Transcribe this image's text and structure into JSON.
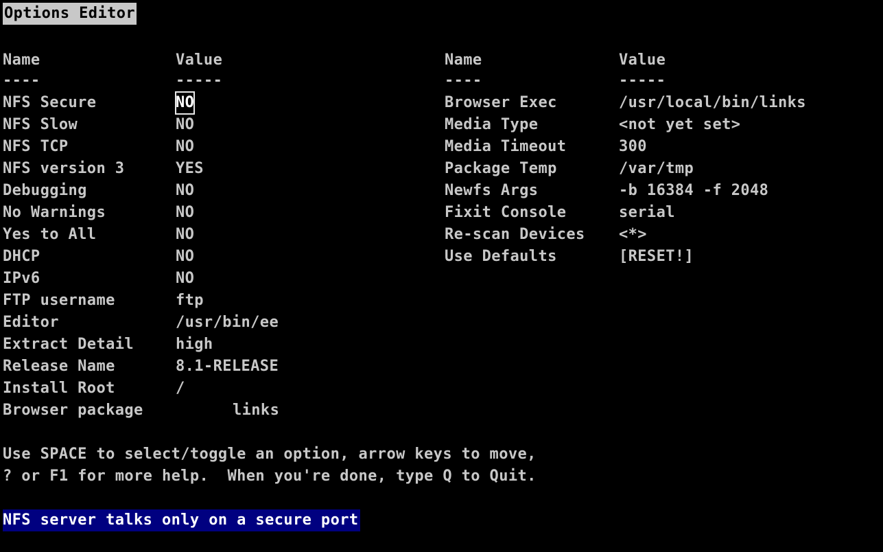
{
  "title": "Options Editor",
  "columns": {
    "name_header": "Name",
    "value_header": "Value",
    "name_rule": "----",
    "value_rule": "-----"
  },
  "left_options": [
    {
      "name": "NFS Secure",
      "value": "NO"
    },
    {
      "name": "NFS Slow",
      "value": "NO"
    },
    {
      "name": "NFS TCP",
      "value": "NO"
    },
    {
      "name": "NFS version 3",
      "value": "YES"
    },
    {
      "name": "Debugging",
      "value": "NO"
    },
    {
      "name": "No Warnings",
      "value": "NO"
    },
    {
      "name": "Yes to All",
      "value": "NO"
    },
    {
      "name": "DHCP",
      "value": "NO"
    },
    {
      "name": "IPv6",
      "value": "NO"
    },
    {
      "name": "FTP username",
      "value": "ftp"
    },
    {
      "name": "Editor",
      "value": "/usr/bin/ee"
    },
    {
      "name": "Extract Detail",
      "value": "high"
    },
    {
      "name": "Release Name",
      "value": "8.1-RELEASE"
    },
    {
      "name": "Install Root",
      "value": "/"
    },
    {
      "name": "Browser package",
      "value": "links"
    }
  ],
  "right_options": [
    {
      "name": "Browser Exec",
      "value": "/usr/local/bin/links"
    },
    {
      "name": "Media Type",
      "value": "<not yet set>"
    },
    {
      "name": "Media Timeout",
      "value": "300"
    },
    {
      "name": "Package Temp",
      "value": "/var/tmp"
    },
    {
      "name": "Newfs Args",
      "value": "-b 16384 -f 2048"
    },
    {
      "name": "Fixit Console",
      "value": "serial"
    },
    {
      "name": "Re-scan Devices",
      "value": "<*>"
    },
    {
      "name": "Use Defaults",
      "value": "[RESET!]"
    }
  ],
  "help": {
    "line1": "Use SPACE to select/toggle an option, arrow keys to move,",
    "line2": "? or F1 for more help.  When you're done, type Q to Quit."
  },
  "status": "NFS server talks only on a secure port",
  "colors": {
    "background": "#000000",
    "text": "#c8c8c8",
    "status_bar": "#000080"
  }
}
